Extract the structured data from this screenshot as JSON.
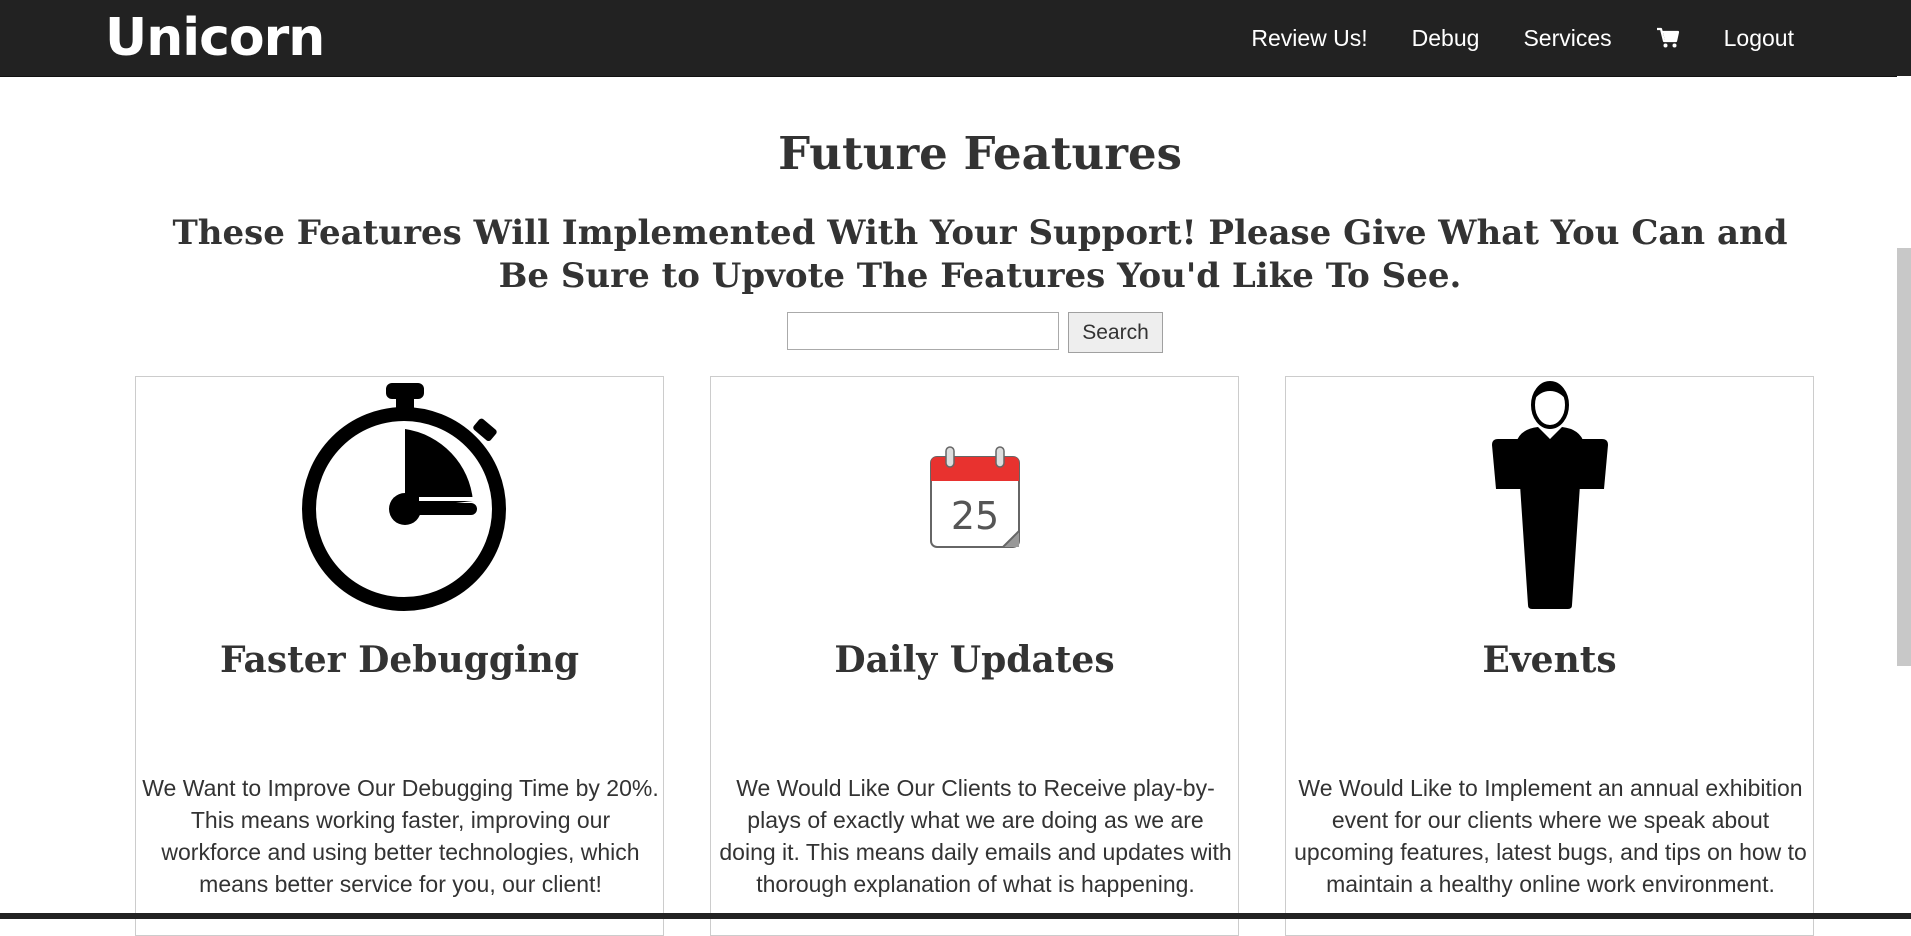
{
  "header": {
    "logo": "Unicorn",
    "nav": [
      {
        "label": "Review Us!"
      },
      {
        "label": "Debug"
      },
      {
        "label": "Services"
      },
      {
        "label": "",
        "icon": "shopping-cart-icon"
      },
      {
        "label": "Logout"
      }
    ]
  },
  "main": {
    "title": "Future Features",
    "subtitle": "These Features Will Implemented With Your Support! Please Give What You Can and Be Sure to Upvote The Features You'd Like To See.",
    "search": {
      "placeholder": "",
      "value": "",
      "button_label": "Search"
    },
    "features": [
      {
        "icon": "stopwatch-icon",
        "title": "Faster Debugging",
        "text": "We Want to Improve Our Debugging Time by 20%. This means working faster, improving our workforce and using better technologies, which means better service for you, our client!"
      },
      {
        "icon": "calendar-icon",
        "calendar_day": "25",
        "title": "Daily Updates",
        "text": "We Would Like Our Clients to Receive play-by-plays of exactly what we are doing as we are doing it. This means daily emails and updates with thorough explanation of what is happening."
      },
      {
        "icon": "speaker-podium-icon",
        "title": "Events",
        "text": "We Would Like to Implement an annual exhibition event for our clients where we speak about upcoming features, latest bugs, and tips on how to maintain a healthy online work environment."
      }
    ]
  },
  "colors": {
    "topbar": "#222222",
    "text": "#333333",
    "calendar_red": "#e8322f"
  }
}
